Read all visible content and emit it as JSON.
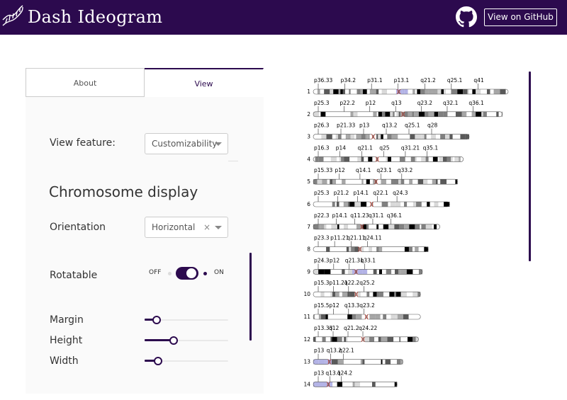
{
  "header": {
    "title": "Dash Ideogram",
    "github_button": "View on GitHub"
  },
  "tabs": [
    {
      "label": "About",
      "active": false
    },
    {
      "label": "View",
      "active": true
    }
  ],
  "controls": {
    "view_feature_label": "View feature:",
    "view_feature_value": "Customizability",
    "section_title": "Chromosome display",
    "orientation_label": "Orientation",
    "orientation_value": "Horizontal",
    "clear_symbol": "×",
    "rotatable_label": "Rotatable",
    "toggle_off": "OFF",
    "toggle_on": "ON",
    "rotatable_on": true,
    "margin_label": "Margin",
    "margin_value": 0.1,
    "height_label": "Height",
    "height_value": 0.33,
    "width_label": "Width",
    "width_value": 0.12
  },
  "colors": {
    "brand": "#2c0a4e",
    "centromere": "#c0392b",
    "heterochromatin": "#b3b3e6"
  },
  "icons": {
    "logo": "dna-helix-icon",
    "github": "github-icon"
  },
  "ideogram": {
    "chromosomes": [
      {
        "num": "1",
        "labels": [
          "p36.33",
          "p34.2",
          "p31.1",
          "p13.1",
          "q21.2",
          "q25.1",
          "q41"
        ],
        "length": 1.0
      },
      {
        "num": "2",
        "labels": [
          "p25.3",
          "p22.2",
          "p12",
          "q13",
          "q23.2",
          "q32.1",
          "q36.1"
        ],
        "length": 0.97
      },
      {
        "num": "3",
        "labels": [
          "p26.3",
          "p21.33",
          "p13",
          "q13.2",
          "q25.1",
          "q28"
        ],
        "length": 0.8
      },
      {
        "num": "4",
        "labels": [
          "p16.3",
          "p14",
          "q21.1",
          "q25",
          "q31.21",
          "q35.1"
        ],
        "length": 0.77
      },
      {
        "num": "5",
        "labels": [
          "p15.33",
          "p12",
          "q14.1",
          "q23.1",
          "q33.2"
        ],
        "length": 0.74
      },
      {
        "num": "6",
        "labels": [
          "p25.3",
          "p21.2",
          "p14.1",
          "q22.1",
          "q24.3"
        ],
        "length": 0.7
      },
      {
        "num": "7",
        "labels": [
          "p22.3",
          "p14.1",
          "q11.23",
          "q31.1",
          "q36.1"
        ],
        "length": 0.65
      },
      {
        "num": "8",
        "labels": [
          "p23.3",
          "p11.21",
          "q21.11",
          "q24.11"
        ],
        "length": 0.59
      },
      {
        "num": "9",
        "labels": [
          "p24.3",
          "p12",
          "q21.31",
          "q33.1"
        ],
        "length": 0.56
      },
      {
        "num": "10",
        "labels": [
          "p15.3",
          "p11.21",
          "q22.2",
          "q25.2"
        ],
        "length": 0.55
      },
      {
        "num": "11",
        "labels": [
          "p15.5",
          "p12",
          "q13.3",
          "q23.2"
        ],
        "length": 0.55
      },
      {
        "num": "12",
        "labels": [
          "p13.33",
          "q12",
          "q21.2",
          "q24.22"
        ],
        "length": 0.54
      },
      {
        "num": "13",
        "labels": [
          "p13",
          "q13.2",
          "q22.1"
        ],
        "length": 0.46
      },
      {
        "num": "14",
        "labels": [
          "p13",
          "q13.1",
          "q24.2"
        ],
        "length": 0.43
      }
    ]
  }
}
